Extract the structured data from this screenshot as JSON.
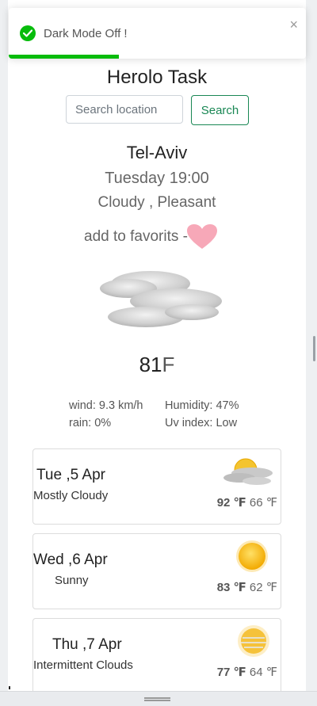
{
  "toast": {
    "message": "Dark Mode Off !",
    "close": "×",
    "progress": 0.37
  },
  "app": {
    "title": "Herolo Task"
  },
  "search": {
    "placeholder": "Search location",
    "button": "Search"
  },
  "current": {
    "city": "Tel-Aviv",
    "datetime": "Tuesday 19:00",
    "condition": "Cloudy , Pleasant",
    "favorite_label": "add to favorits -",
    "temperature": "81",
    "unit": "F",
    "wind": "wind: 9.3 km/h",
    "humidity": "Humidity: 47%",
    "rain": "rain: 0%",
    "uv": "Uv index: Low",
    "icon": "cloud-icon"
  },
  "forecast": [
    {
      "day": "Tue ,5 Apr",
      "desc": "Mostly Cloudy",
      "high": "92 ℉",
      "low": "66 ℉",
      "icon": "sun-cloud-icon"
    },
    {
      "day": "Wed ,6 Apr",
      "desc": "Sunny",
      "high": "83 ℉",
      "low": "62 ℉",
      "icon": "sun-icon"
    },
    {
      "day": "Thu ,7 Apr",
      "desc": "Intermittent Clouds",
      "high": "77 ℉",
      "low": "64 ℉",
      "icon": "hazy-sun-icon"
    }
  ],
  "colors": {
    "success": "#07bc0c",
    "search_button": "#198754",
    "heart": "#f7a8b8"
  }
}
